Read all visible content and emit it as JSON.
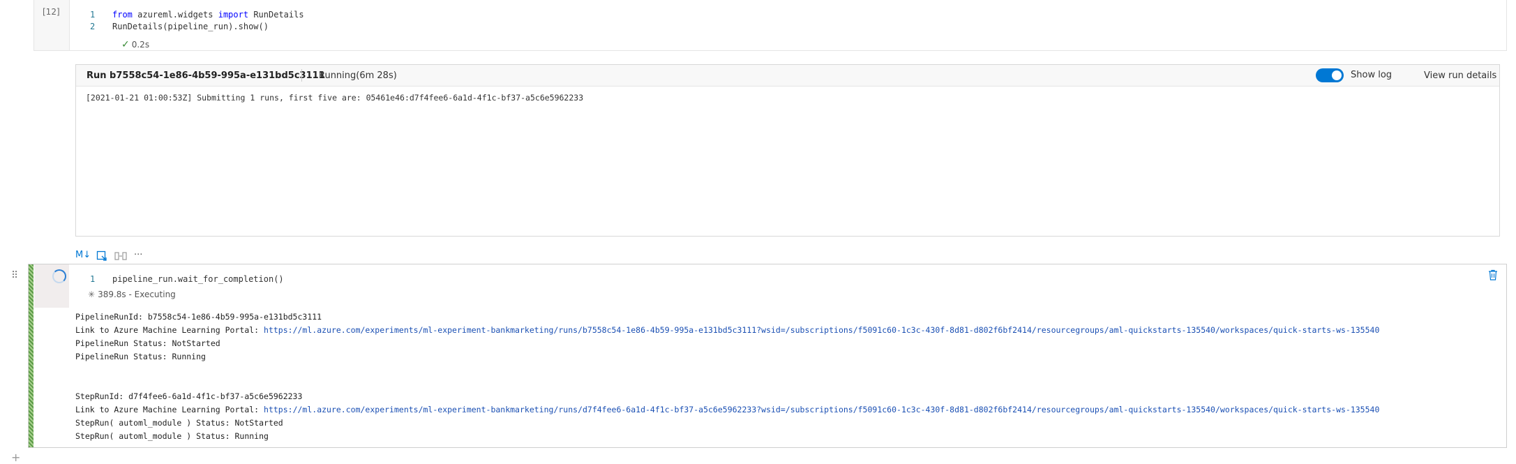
{
  "cell1": {
    "exec_count": "[12]",
    "lines": [
      {
        "num": "1",
        "kw1": "from",
        "mod": " azureml.widgets ",
        "kw2": "import",
        "rest": " RunDetails"
      },
      {
        "num": "2",
        "text": "RunDetails(pipeline_run).show()"
      }
    ],
    "status": "0.2s"
  },
  "widget": {
    "run_title": "Run b7558c54-1e86-4b59-995a-e131bd5c3111",
    "run_status": "Running(6m 28s)",
    "show_log_label": "Show log",
    "show_log_on": true,
    "view_run_label": "View run details",
    "log": "[2021-01-21 01:00:53Z] Submitting 1 runs, first five are: 05461e46:d7f4fee6-6a1d-4f1c-bf37-a5c6e5962233"
  },
  "toolbar": {
    "markdown_label": "M↓",
    "dots_label": "···"
  },
  "cell2": {
    "line_num": "1",
    "code": "pipeline_run.wait_for_completion()",
    "status": "389.8s - Executing",
    "output": {
      "l1": "PipelineRunId: b7558c54-1e86-4b59-995a-e131bd5c3111",
      "l2_prefix": "Link to Azure Machine Learning Portal: ",
      "l2_link": "https://ml.azure.com/experiments/ml-experiment-bankmarketing/runs/b7558c54-1e86-4b59-995a-e131bd5c3111?wsid=/subscriptions/f5091c60-1c3c-430f-8d81-d802f6bf2414/resourcegroups/aml-quickstarts-135540/workspaces/quick-starts-ws-135540",
      "l3": "PipelineRun Status: NotStarted",
      "l4": "PipelineRun Status: Running",
      "l5": "StepRunId: d7f4fee6-6a1d-4f1c-bf37-a5c6e5962233",
      "l6_prefix": "Link to Azure Machine Learning Portal: ",
      "l6_link": "https://ml.azure.com/experiments/ml-experiment-bankmarketing/runs/d7f4fee6-6a1d-4f1c-bf37-a5c6e5962233?wsid=/subscriptions/f5091c60-1c3c-430f-8d81-d802f6bf2414/resourcegroups/aml-quickstarts-135540/workspaces/quick-starts-ws-135540",
      "l7": "StepRun( automl_module ) Status: NotStarted",
      "l8": "StepRun( automl_module ) Status: Running"
    }
  },
  "colors": {
    "accent": "#0078d4",
    "link": "#1a4fb3",
    "success": "#388a34",
    "running_bar": "#5b9b48"
  },
  "icons": [
    "check-icon",
    "toggle-switch",
    "markdown-icon",
    "select-cell-icon",
    "split-cell-icon",
    "more-icon",
    "drag-handle-icon",
    "spinner-icon",
    "trash-icon",
    "executing-icon",
    "add-cell-icon"
  ]
}
